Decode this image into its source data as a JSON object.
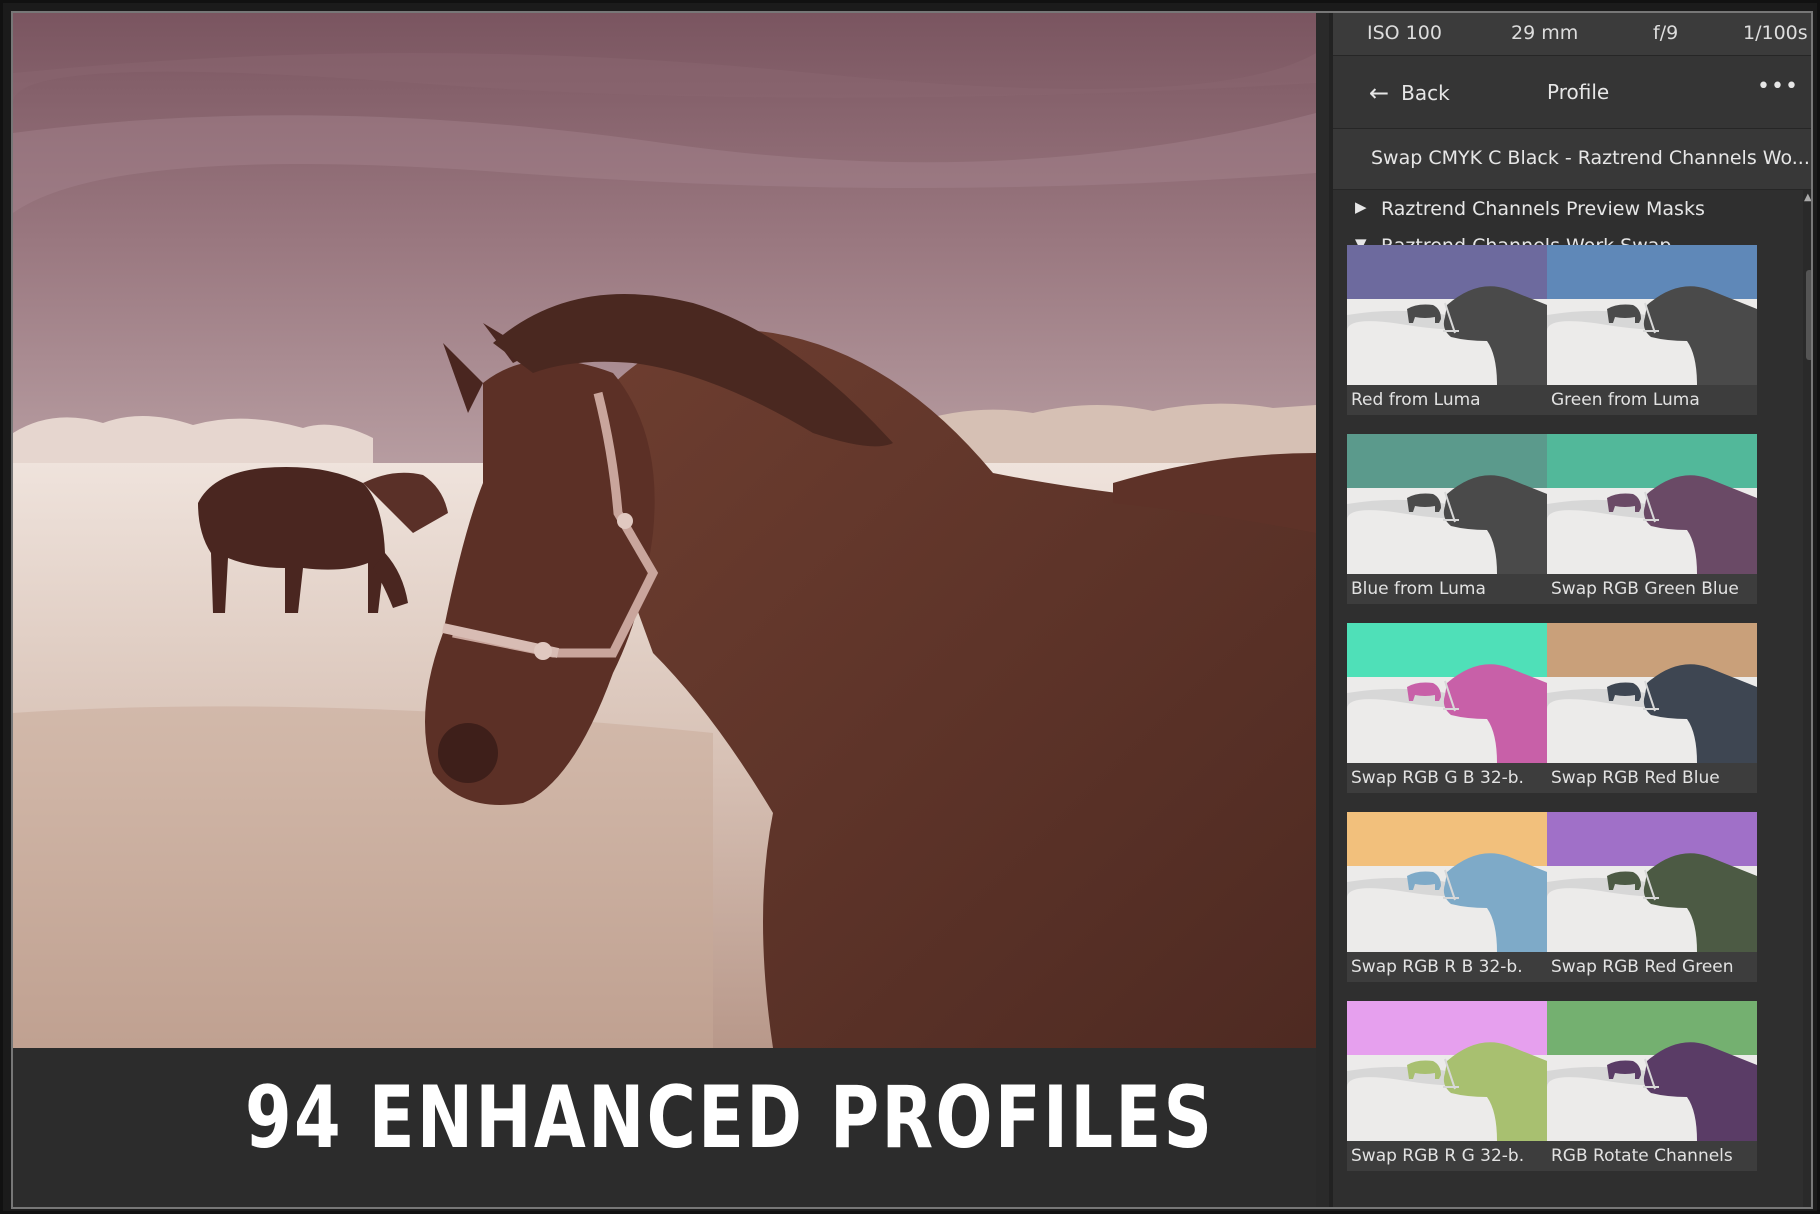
{
  "exif": {
    "iso": "ISO 100",
    "focal": "29 mm",
    "aperture": "f/9",
    "shutter": "1/100s"
  },
  "nav": {
    "back_label": "Back",
    "title": "Profile",
    "more_icon": "ellipsis-icon",
    "back_icon": "arrow-left-icon"
  },
  "current_profile": "Swap CMYK C Black - Raztrend Channels Wo...",
  "groups": [
    {
      "label": "Raztrend Channels Preview Masks",
      "expanded": false
    },
    {
      "label": "Raztrend Channels Work Swap",
      "expanded": true
    }
  ],
  "profiles": [
    {
      "label": "Red from Luma",
      "sky": "#6d6a9e",
      "horse": "#4a4a4a"
    },
    {
      "label": "Green from Luma",
      "sky": "#5f88b8",
      "horse": "#4a4a4a"
    },
    {
      "label": "Blue from Luma",
      "sky": "#5b9a8c",
      "horse": "#4a4a4a"
    },
    {
      "label": "Swap RGB Green Blue",
      "sky": "#52b89a",
      "horse": "#6a4a66"
    },
    {
      "label": "Swap RGB G B 32-b.",
      "sky": "#4fe0b8",
      "horse": "#c860a8"
    },
    {
      "label": "Swap RGB Red Blue",
      "sky": "#c9a07a",
      "horse": "#3e4652"
    },
    {
      "label": "Swap RGB R B 32-b.",
      "sky": "#f2c07c",
      "horse": "#7eaac8"
    },
    {
      "label": "Swap RGB Red Green",
      "sky": "#a070c8",
      "horse": "#4c5a44"
    },
    {
      "label": "Swap RGB R G 32-b.",
      "sky": "#e6a0ee",
      "horse": "#a8c070"
    },
    {
      "label": "RGB Rotate Channels",
      "sky": "#74b070",
      "horse": "#5a3c66"
    }
  ],
  "banner": {
    "text": "94 ENHANCED PROFILES"
  },
  "colors": {
    "panel_bg": "#333333",
    "photo_tone": "#6b3a2c",
    "banner_bg": "#2c2c2c"
  }
}
